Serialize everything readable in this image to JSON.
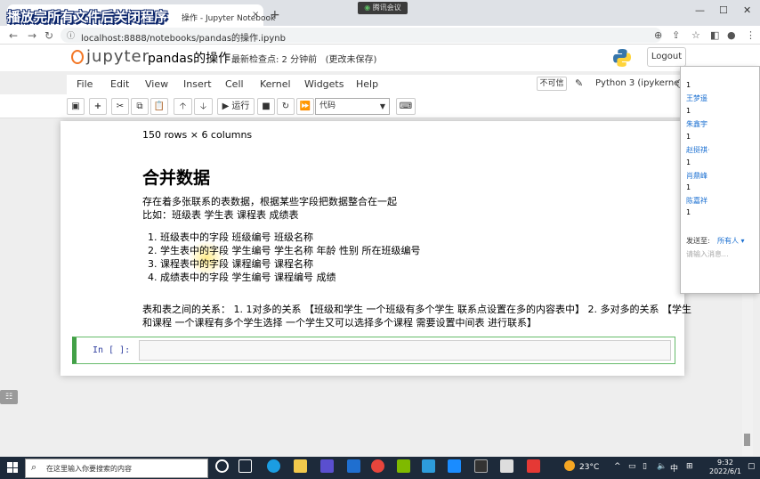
{
  "overlay_text": "播放完所有文件后关闭程序",
  "meeting_label": "腾讯会议",
  "tab": {
    "title": "操作 - Jupyter Notebook",
    "close": "×",
    "new": "+"
  },
  "window": {
    "minimize": "—",
    "maximize": "☐",
    "close": "✕"
  },
  "address": {
    "url": "localhost:8888/notebooks/pandas的操作.ipynb"
  },
  "jupyter": {
    "logo": "jupyter",
    "notebook_name": "pandas的操作",
    "checkpoint": "最新检查点: 2 分钟前",
    "unsaved": "(更改未保存)",
    "logout": "Logout"
  },
  "menu": [
    "File",
    "Edit",
    "View",
    "Insert",
    "Cell",
    "Kernel",
    "Widgets",
    "Help"
  ],
  "untrusted": "不可信",
  "kernel_name": "Python 3 (ipykernel)",
  "toolbar": {
    "run": "▶ 运行",
    "cell_type": "代码"
  },
  "content": {
    "rows_cols": "150 rows × 6 columns",
    "heading": "合并数据",
    "p1": "存在着多张联系的表数据，根据某些字段把数据整合在一起",
    "p2": "比如：班级表 学生表 课程表 成绩表",
    "list": [
      "1. 班级表中的字段 班级编号 班级名称",
      "2. 学生表中的字段 学生编号 学生名称 年龄 性别 所在班级编号",
      "3. 课程表中的字段 课程编号 课程名称",
      "4. 成绩表中的字段 学生编号 课程编号 成绩"
    ],
    "rel1": "表和表之间的关系： 1. 1对多的关系 【班级和学生 一个班级有多个学生 联系点设置在多的内容表中】 2. 多对多的关系 【学生",
    "rel2": "和课程 一个课程有多个学生选择 一个学生又可以选择多个课程 需要设置中间表 进行联系】"
  },
  "cell_prompt": "In  [ ]:",
  "chat": {
    "messages": [
      {
        "text": "1"
      },
      {
        "name": "王梦遥",
        "text": "1"
      },
      {
        "name": "朱鑫宇",
        "text": "1"
      },
      {
        "name": "赵挺祺·",
        "text": "1"
      },
      {
        "name": "肖鼎峰",
        "text": "1"
      },
      {
        "name": "陈嘉祥",
        "text": "1"
      }
    ],
    "send_to": "发送至:",
    "everyone": "所有人 ▾",
    "input_placeholder": "请输入消息..."
  },
  "side_button": "☷",
  "taskbar": {
    "search_placeholder": "在这里输入你要搜索的内容",
    "temperature": "23°C",
    "lang": "中",
    "time": "9:32",
    "date": "2022/6/1"
  }
}
